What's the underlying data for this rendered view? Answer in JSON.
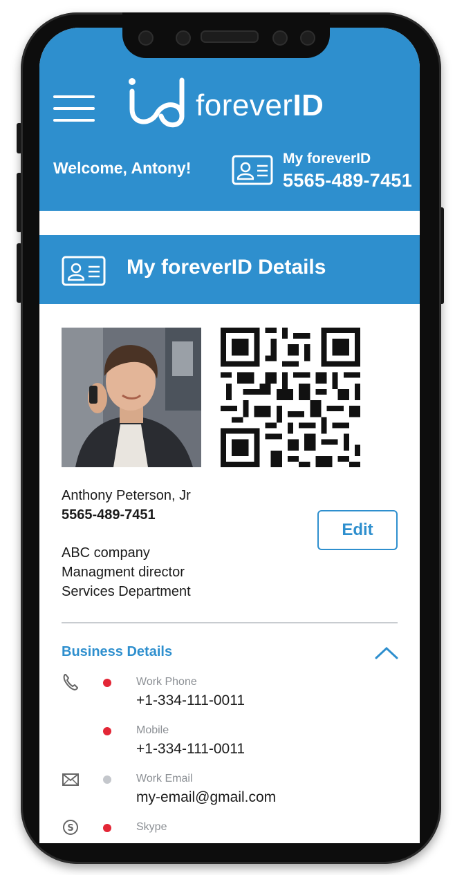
{
  "app": {
    "logo_text_light": "forever",
    "logo_text_bold": "ID"
  },
  "header": {
    "welcome": "Welcome, Antony!",
    "my_id_label": "My foreverID",
    "my_id_number": "5565-489-7451"
  },
  "section": {
    "title": "My foreverID Details"
  },
  "profile": {
    "name": "Anthony Peterson, Jr",
    "id_number": "5565-489-7451",
    "company": "ABC company",
    "title": "Managment director",
    "department": "Services Department",
    "edit_label": "Edit"
  },
  "business": {
    "title": "Business Details",
    "rows": [
      {
        "label": "Work Phone",
        "value": "+1-334-111-0011",
        "icon": "phone-icon",
        "status_color": "#e32636"
      },
      {
        "label": "Mobile",
        "value": "+1-334-111-0011",
        "icon": "",
        "status_color": "#e32636"
      },
      {
        "label": "Work Email",
        "value": "my-email@gmail.com",
        "icon": "envelope-icon",
        "status_color": "#c4c7cc"
      },
      {
        "label": "Skype",
        "value": "",
        "icon": "skype-icon",
        "status_color": "#e32636"
      }
    ]
  },
  "colors": {
    "accent": "#2e8fce",
    "header_bg": "#2e8fce",
    "dot_red": "#e32636",
    "dot_grey": "#c4c7cc"
  }
}
